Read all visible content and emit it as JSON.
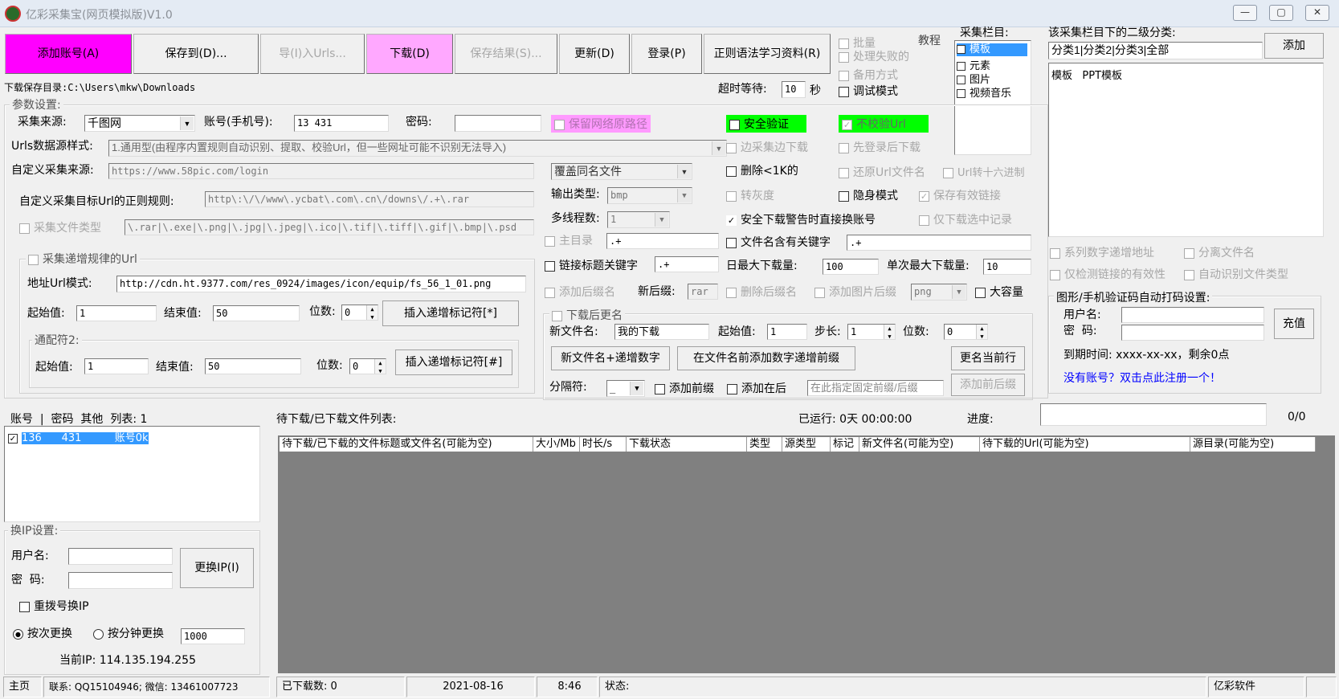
{
  "window": {
    "title": "亿彩采集宝(网页模拟版)V1.0",
    "minimize": "—",
    "maximize": "▢",
    "close": "✕"
  },
  "toolbar": {
    "add_account": "添加账号(A)",
    "save_to": "保存到(D)...",
    "import_urls": "导(I)入Urls...",
    "download": "下载(D)",
    "save_result": "保存结果(S)...",
    "update": "更新(D)",
    "login": "登录(P)",
    "regex_docs": "正则语法学习资料(R)"
  },
  "options_top": {
    "batch": "批量",
    "tutorial": "教程",
    "retry_failed": "处理失败的",
    "backup_mode": "备用方式",
    "debug_mode": "调试模式"
  },
  "category": {
    "label": "采集栏目:",
    "items": [
      {
        "label": "模板",
        "checked": true,
        "selected": true
      },
      {
        "label": "元素",
        "checked": false
      },
      {
        "label": "图片",
        "checked": false
      },
      {
        "label": "视频音乐",
        "checked": false
      }
    ]
  },
  "subcategory": {
    "label": "该采集栏目下的二级分类:",
    "input_value": "分类1|分类2|分类3|全部",
    "add_button": "添加",
    "list_item": "模板   PPT模板"
  },
  "download_dir": "下载保存目录:C:\\Users\\mkw\\Downloads",
  "timeout": {
    "label": "超时等待:",
    "value": "10",
    "unit": "秒"
  },
  "params": {
    "group_label": "参数设置:",
    "source_label": "采集来源:",
    "source_value": "千图网",
    "account_label": "账号(手机号):",
    "account_value": "13      431",
    "password_label": "密码:",
    "password_value": "",
    "keep_path": "保留网络原路径",
    "safe_verify": "安全验证",
    "no_verify_url": "不校验Url",
    "url_style_label": "Urls数据源样式:",
    "url_style_value": "1.通用型(由程序内置规则自动识别、提取、校验Url，但一些网址可能不识别无法导入)",
    "custom_source_label": "自定义采集来源:",
    "custom_source_value": "https://www.58pic.com/login",
    "custom_regex_label": "自定义采集目标Url的正则规则:",
    "custom_regex_value": "http\\:\\/\\/www\\.ycbat\\.com\\.cn\\/downs\\/.+\\.rar",
    "file_type_label": "采集文件类型",
    "file_type_value": "\\.rar|\\.exe|\\.png|\\.jpg|\\.jpeg|\\.ico|\\.tif|\\.tiff|\\.gif|\\.bmp|\\.psd"
  },
  "increment": {
    "group_label": "采集递增规律的Url",
    "url_pattern_label": "地址Url模式:",
    "url_pattern_value": "http://cdn.ht.9377.com/res_0924/images/icon/equip/fs_56_1_01.png",
    "start_label": "起始值:",
    "start_value": "1",
    "end_label": "结束值:",
    "end_value": "50",
    "digits_label": "位数:",
    "digits_value": "0",
    "insert_button": "插入递增标记符[*]",
    "wildcard_label": "通配符2:",
    "start2_value": "1",
    "end2_value": "50",
    "digits2_value": "0",
    "insert2_button": "插入递增标记符[#]"
  },
  "middle": {
    "overwrite": "覆盖同名文件",
    "output_type_label": "输出类型:",
    "output_type_value": "bmp",
    "threads_label": "多线程数:",
    "threads_value": "1",
    "main_dir": "主目录",
    "main_dir_value": ".+",
    "link_title_kw": "链接标题关键字",
    "link_title_value": ".+",
    "add_suffix": "添加后缀名",
    "new_suffix_label": "新后缀:",
    "new_suffix_value": "rar"
  },
  "right_opts": {
    "collect_download": "边采集边下载",
    "login_first": "先登录后下载",
    "delete_small": "删除<1K的",
    "restore_url_name": "还原Url文件名",
    "url_hex": "Url转十六进制",
    "grayscale": "转灰度",
    "stealth": "隐身模式",
    "save_valid": "保存有效链接",
    "safe_switch": "安全下载警告时直接换账号",
    "only_selected": "仅下载选中记录",
    "name_has_kw": "文件名含有关键字",
    "name_kw_value": ".+",
    "daily_max_label": "日最大下载量:",
    "daily_max_value": "100",
    "single_max_label": "单次最大下载量:",
    "single_max_value": "10",
    "delete_suffix": "删除后缀名",
    "add_img_suffix": "添加图片后缀",
    "img_suffix_value": "png",
    "large_capacity": "大容量"
  },
  "rename": {
    "group_label": "下载后更名",
    "new_name_label": "新文件名:",
    "new_name_value": "我的下载",
    "start_label": "起始值:",
    "start_value": "1",
    "step_label": "步长:",
    "step_value": "1",
    "digits_label": "位数:",
    "digits_value": "0",
    "btn_name_incr": "新文件名+递增数字",
    "btn_prefix_incr": "在文件名前添加数字递增前缀",
    "btn_rename_row": "更名当前行",
    "separator_label": "分隔符:",
    "separator_value": "_",
    "add_prefix": "添加前缀",
    "add_after": "添加在后",
    "fixed_placeholder": "在此指定固定前缀/后缀",
    "btn_add_prefix": "添加前后缀"
  },
  "right_lower": {
    "series_addr": "系列数字递增地址",
    "split_name": "分离文件名",
    "check_links": "仅检测链接的有效性",
    "auto_type": "自动识别文件类型",
    "captcha_group": "图形/手机验证码自动打码设置:",
    "user_label": "用户名:",
    "pass_label": "密  码:",
    "recharge": "充值",
    "expire": "到期时间: xxxx-xx-xx，剩余0点",
    "register_link": "没有账号？双击点此注册一个！"
  },
  "accounts": {
    "header": "账号  |  密码  其他  列表: 1",
    "row": "136      431          账号0k"
  },
  "proxy": {
    "group_label": "换IP设置:",
    "user_label": "用户名:",
    "pass_label": "密  码:",
    "change_btn": "更换IP(I)",
    "redial": "重拨号换IP",
    "by_count": "按次更换",
    "by_minute": "按分钟更换",
    "minute_value": "1000",
    "current_ip": "当前IP: 114.135.194.255"
  },
  "filelist": {
    "title": "待下载/已下载文件列表:",
    "running": "已运行: 0天 00:00:00",
    "progress_label": "进度:",
    "progress_value": 0,
    "progress_text": "0/0",
    "columns": [
      "待下载/已下载的文件标题或文件名(可能为空)",
      "大小/Mb",
      "时长/s",
      "下载状态",
      "类型",
      "源类型",
      "标记",
      "新文件名(可能为空)",
      "待下载的Url(可能为空)",
      "源目录(可能为空)"
    ]
  },
  "statusbar": {
    "home": "主页",
    "contact": "联系: QQ15104946; 微信: 13461007723",
    "downloaded": "已下载数: 0",
    "date": "2021-08-16",
    "time": "8:46",
    "status": "状态:",
    "brand": "亿彩软件"
  },
  "colors": {
    "magenta": "#ff00ff",
    "pink": "#ff9aff",
    "green": "#00ff00",
    "grid_bg": "#808080",
    "selection": "#3399ff",
    "link": "#0000ff"
  }
}
